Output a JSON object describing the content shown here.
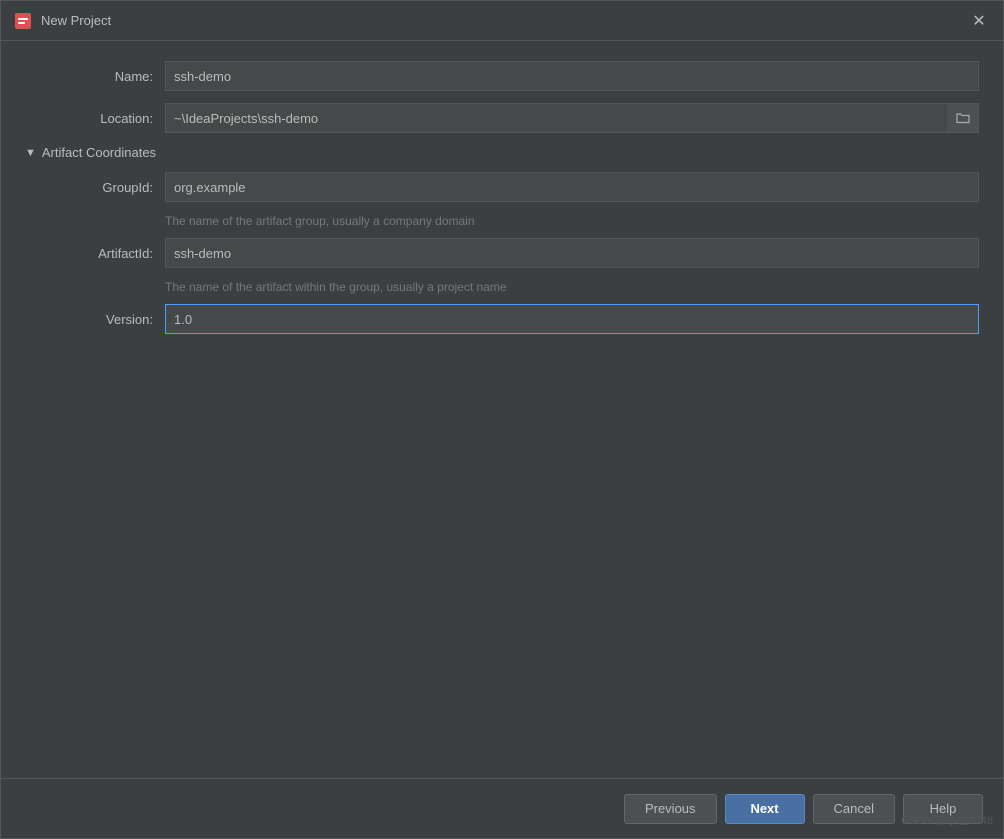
{
  "dialog": {
    "title": "New Project",
    "close_label": "✕"
  },
  "form": {
    "name_label": "Name:",
    "name_value": "ssh-demo",
    "location_label": "Location:",
    "location_value": "~\\IdeaProjects\\ssh-demo",
    "artifact_section_label": "Artifact Coordinates",
    "artifact_toggle": "▼",
    "groupid_label": "GroupId:",
    "groupid_value": "org.example",
    "groupid_hint": "The name of the artifact group, usually a company domain",
    "artifactid_label": "ArtifactId:",
    "artifactid_value": "ssh-demo",
    "artifactid_hint": "The name of the artifact within the group, usually a project name",
    "version_label": "Version:",
    "version_value": "1.0"
  },
  "footer": {
    "previous_label": "Previous",
    "next_label": "Next",
    "cancel_label": "Cancel",
    "help_label": "Help"
  },
  "watermark": "CSDN @小超0748"
}
